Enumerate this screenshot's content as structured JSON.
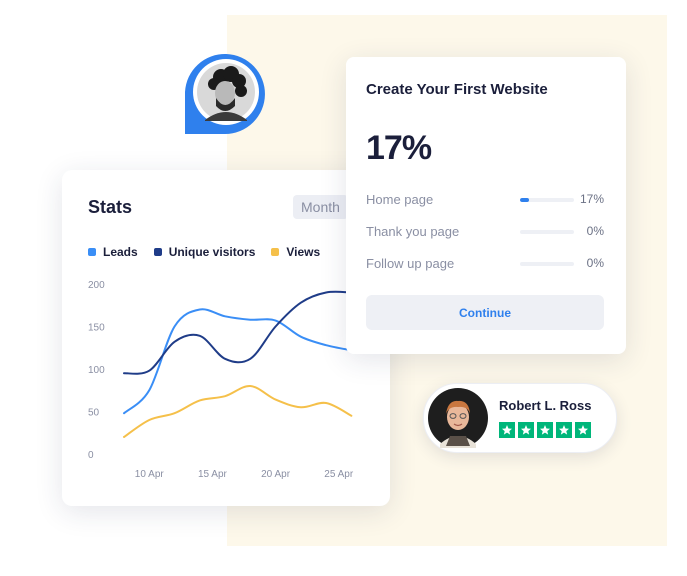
{
  "stats": {
    "title": "Stats",
    "period": "Month",
    "legend": [
      {
        "label": "Leads",
        "color": "#3a8ef6"
      },
      {
        "label": "Unique visitors",
        "color": "#1f3c88"
      },
      {
        "label": "Views",
        "color": "#f5c04a"
      }
    ]
  },
  "chart_data": {
    "type": "line",
    "title": "Stats",
    "x": [
      8,
      10,
      12,
      14,
      16,
      18,
      20,
      22,
      24,
      26
    ],
    "x_tick_labels": [
      "10 Apr",
      "15 Apr",
      "20 Apr",
      "25 Apr"
    ],
    "x_tick_positions": [
      10,
      15,
      20,
      25
    ],
    "yticks": [
      0,
      50,
      100,
      150,
      200
    ],
    "ylim": [
      0,
      200
    ],
    "grid": false,
    "legend_position": "top-left",
    "series": [
      {
        "name": "Leads",
        "color": "#3a8ef6",
        "values": [
          48,
          75,
          150,
          170,
          162,
          158,
          157,
          138,
          128,
          122
        ]
      },
      {
        "name": "Unique visitors",
        "color": "#1f3c88",
        "values": [
          95,
          98,
          132,
          139,
          112,
          112,
          150,
          178,
          190,
          190
        ]
      },
      {
        "name": "Views",
        "color": "#f5c04a",
        "values": [
          20,
          40,
          48,
          63,
          68,
          80,
          64,
          55,
          60,
          45
        ]
      }
    ]
  },
  "progress": {
    "title": "Create Your First Website",
    "percent": "17%",
    "rows": [
      {
        "label": "Home page",
        "value": "17%",
        "fill": 0.17
      },
      {
        "label": "Thank you page",
        "value": "0%",
        "fill": 0
      },
      {
        "label": "Follow up page",
        "value": "0%",
        "fill": 0
      }
    ],
    "button_label": "Continue"
  },
  "review": {
    "name": "Robert L. Ross",
    "stars": 5,
    "star_color": "#00b67a"
  },
  "pin": {
    "ring_color": "#2f80ed",
    "icon": "user-avatar-pin-icon"
  }
}
